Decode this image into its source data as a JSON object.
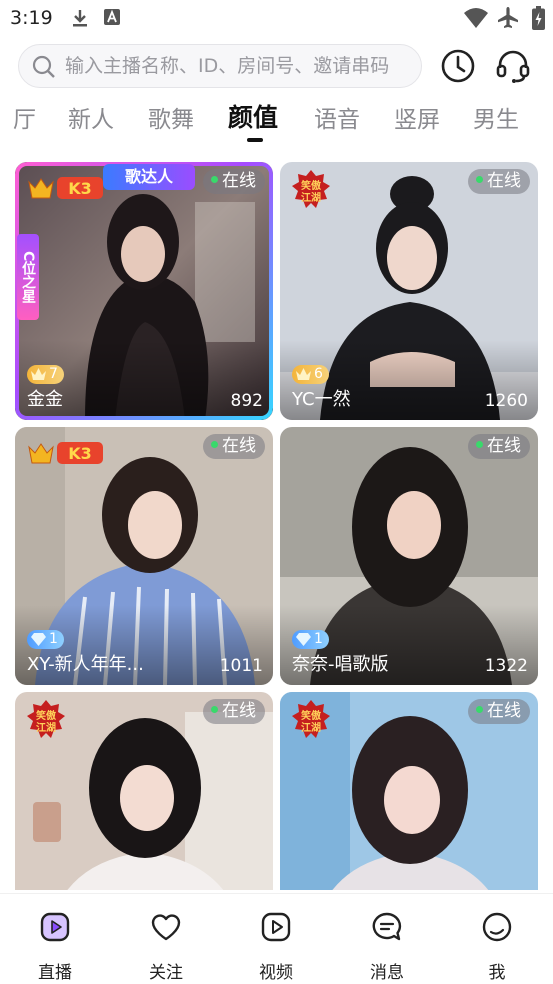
{
  "status_bar": {
    "time": "3:19",
    "left_icons": [
      "download-icon",
      "app-notification-icon"
    ],
    "right_icons": [
      "wifi-icon",
      "airplane-mode-icon",
      "battery-charging-icon"
    ]
  },
  "header": {
    "search_placeholder": "输入主播名称、ID、房间号、邀请串码",
    "history_icon": "clock-icon",
    "service_icon": "headset-icon"
  },
  "tabs": [
    {
      "label": "厅",
      "active": false
    },
    {
      "label": "新人",
      "active": false
    },
    {
      "label": "歌舞",
      "active": false
    },
    {
      "label": "颜值",
      "active": true
    },
    {
      "label": "语音",
      "active": false
    },
    {
      "label": "竖屏",
      "active": false
    },
    {
      "label": "男生",
      "active": false
    }
  ],
  "cards": [
    {
      "name": "金金",
      "viewers": "892",
      "status": "在线",
      "level": "7",
      "level_type": "crown",
      "corner_badge": "K3",
      "top_banner": "歌达人",
      "side_banner": "C位之星"
    },
    {
      "name": "YC一然",
      "viewers": "1260",
      "status": "在线",
      "level": "6",
      "level_type": "crown",
      "corner_badge": "笑傲江湖"
    },
    {
      "name": "XY-新人年年...",
      "viewers": "1011",
      "status": "在线",
      "level": "1",
      "level_type": "diamond",
      "corner_badge": "K3"
    },
    {
      "name": "奈奈-唱歌版",
      "viewers": "1322",
      "status": "在线",
      "level": "1",
      "level_type": "diamond",
      "corner_badge": ""
    },
    {
      "name": "",
      "viewers": "",
      "status": "在线",
      "level": "",
      "level_type": "",
      "corner_badge": "笑傲江湖"
    },
    {
      "name": "",
      "viewers": "",
      "status": "在线",
      "level": "",
      "level_type": "",
      "corner_badge": "笑傲江湖"
    }
  ],
  "bottom_nav": [
    {
      "label": "直播",
      "icon": "live-play-icon",
      "active": true
    },
    {
      "label": "关注",
      "icon": "heart-icon",
      "active": false
    },
    {
      "label": "视频",
      "icon": "video-play-icon",
      "active": false
    },
    {
      "label": "消息",
      "icon": "message-icon",
      "active": false
    },
    {
      "label": "我",
      "icon": "profile-icon",
      "active": false
    }
  ],
  "colors": {
    "accent": "#8a4cff",
    "online_dot": "#39d96b",
    "gold_level": "#f4b43a",
    "diamond_level": "#4f9cff",
    "badge_red": "#e8432c"
  }
}
